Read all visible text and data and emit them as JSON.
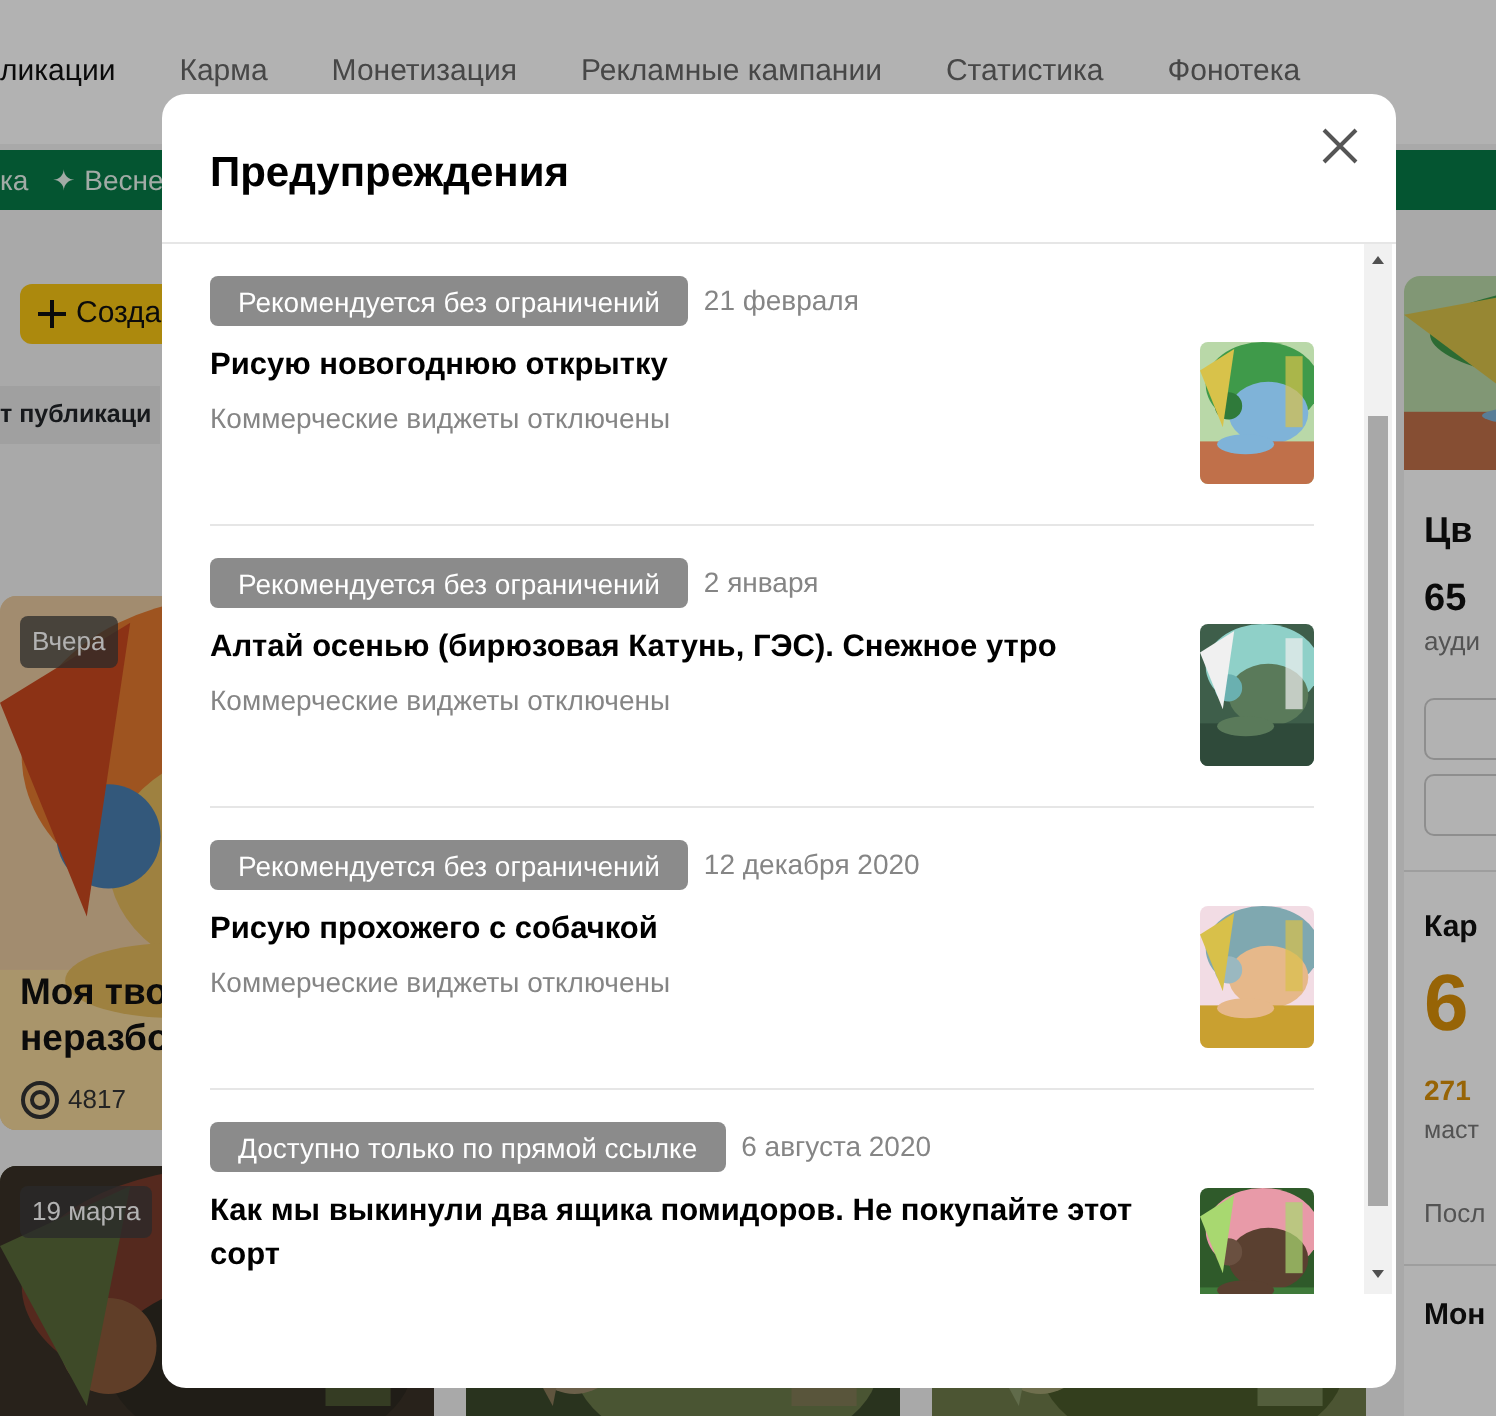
{
  "background_page": {
    "nav_tabs": [
      {
        "label": "ликации",
        "selected": true
      },
      {
        "label": "Карма",
        "selected": false
      },
      {
        "label": "Монетизация",
        "selected": false
      },
      {
        "label": "Рекламные кампании",
        "selected": false
      },
      {
        "label": "Статистика",
        "selected": false
      },
      {
        "label": "Фонотека",
        "selected": false
      }
    ],
    "promo_bar": [
      "ка",
      "✦ Весне"
    ],
    "create_button": "Созда",
    "filter_label": "т публикаци",
    "cards": [
      {
        "date": "Вчера",
        "title_lines": [
          "Моя тво",
          "неразбо"
        ],
        "views": "4817"
      },
      {
        "date": "19 марта"
      }
    ],
    "channel_card": {
      "name": "Цв",
      "count": "65",
      "count_label": "ауди"
    },
    "karma_card": {
      "title": "Кар",
      "value": "6",
      "sub_value": "271",
      "sub_label": "маст",
      "footer": "Посл"
    },
    "monetization_card": {
      "title": "Мон"
    }
  },
  "dialog": {
    "title": "Предупреждения",
    "items": [
      {
        "status": "Рекомендуется без ограничений",
        "date": "21 февраля",
        "title": "Рисую новогоднюю открытку",
        "note": "Коммерческие виджеты отключены"
      },
      {
        "status": "Рекомендуется без ограничений",
        "date": "2 января",
        "title": "Алтай осенью (бирюзовая Катунь, ГЭС). Снежное утро",
        "note": "Коммерческие виджеты отключены"
      },
      {
        "status": "Рекомендуется без ограничений",
        "date": "12 декабря 2020",
        "title": "Рисую прохожего с собачкой",
        "note": "Коммерческие виджеты отключены"
      },
      {
        "status": "Доступно только по прямой ссылке",
        "date": "6 августа 2020",
        "title": "Как мы выкинули два ящика помидоров. Не покупайте этот сорт"
      }
    ]
  }
}
